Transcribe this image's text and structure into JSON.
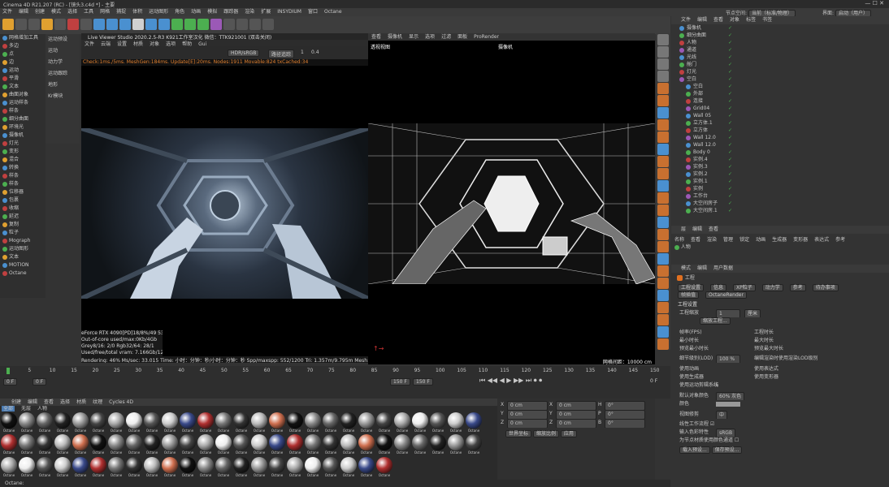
{
  "window": {
    "title": "Cinema 4D R21.207 (RC) - [镜头3.c4d *] - 主要"
  },
  "menubar": [
    "文件",
    "编辑",
    "创建",
    "模式",
    "选择",
    "工具",
    "网格",
    "捕捉",
    "体积",
    "运动图形",
    "角色",
    "动画",
    "模拟",
    "跟踪器",
    "渲染",
    "扩展",
    "INSYDIUM",
    "窗口",
    "Octane"
  ],
  "layout": {
    "label": "节点空间:",
    "value": "当前（标准/物理）",
    "interface_label": "界面:",
    "interface_value": "启动（用户）"
  },
  "left_sidebar": {
    "items": [
      "网格增加工具",
      "多边",
      "点",
      "边",
      "运动",
      "平滑",
      "文本",
      "曲面对象",
      "运动样条",
      "样条",
      "细分曲面",
      "环境光",
      "摄像机",
      "灯光",
      "变形",
      "混合",
      "转换",
      "样条",
      "样条",
      "位移器",
      "包裹",
      "收缩",
      "延迟",
      "复制",
      "粒子",
      "Mograph",
      "运动图形",
      "文本",
      "MOTION",
      "Octane"
    ],
    "tools": [
      "地图",
      "草图",
      "反射",
      "扭曲",
      "旋转",
      "挤压",
      "球化",
      "锥化",
      "样条",
      "螺旋",
      "循环",
      "运动样条",
      "多边形",
      "样条",
      "折纸",
      "点",
      "投射",
      "散射"
    ]
  },
  "mid_panel": {
    "items": [
      "运动预设",
      "运动",
      "动力学",
      "运动跟踪",
      "地形",
      "Kr模块"
    ],
    "selected": "XP系统"
  },
  "octane_viewer": {
    "title": "Live Viewer Studio 2020.2.5-R3  K921工作室汉化  微信：TTK921001  (双击关闭)",
    "menus": [
      "文件",
      "云端",
      "设置",
      "材质",
      "对象",
      "选项",
      "帮助",
      "Gui"
    ],
    "color_mode": "HDR/sRGB",
    "mode": "路径追踪",
    "value1": "1",
    "value2": "0.4",
    "status": "Check:1ms./5ms. MeshGen:184ms. Update[E]:20ms. Nodes:1911 Movable:824 txCached:34",
    "info_lines": [
      "eForce RTX 4090[PD]18/8%/49   53",
      "Out-of-core used/max:0Kb/4Gb",
      "Grey8/16: 2/0          Rgb32/64: 28/1",
      "Used/free/total vram: 7.166Gb/12.159Gb/2"
    ],
    "render_line": "Rendering: 46%  Ms/sec: 33.015  Time: 小时：分钟：秒/小时：分钟：秒   Spp/maxspp: 552/1200   Tri: 1.357m/9.795m   Mesh: 837   Hair: 0   RTXon"
  },
  "viewport": {
    "menus": [
      "查看",
      "摄像机",
      "显示",
      "选项",
      "过滤",
      "面板",
      "ProRender"
    ],
    "label": "透视视图",
    "camera": "摄像机",
    "grid": "网格间距：10000 cm"
  },
  "object_manager": {
    "tabs": [
      "文件",
      "编辑",
      "查看",
      "对象",
      "标签",
      "书签"
    ],
    "objects": [
      "摄像机",
      "细分曲面",
      "人物",
      "通道",
      "光线",
      "舱门",
      "灯光",
      "空白",
      "空白",
      "外部",
      "连接",
      "Grid04",
      "Wall 05",
      "立方体.1",
      "立方体",
      "Wall 12.0",
      "Wall 12.0",
      "Body 0",
      "实例.4",
      "实例.3",
      "实例.2",
      "实例.1",
      "实例",
      "工作台",
      "大空间房子",
      "大空间房.1"
    ]
  },
  "layer_panel": {
    "tabs": [
      "层",
      "编辑",
      "查看"
    ],
    "cols": [
      "名称",
      "查看",
      "渲染",
      "管理",
      "锁定",
      "动画",
      "生成器",
      "变形器",
      "表达式",
      "参考"
    ],
    "row": "人物"
  },
  "attributes": {
    "tabs": [
      "模式",
      "编辑",
      "用户数据"
    ],
    "title": "工程",
    "subtabs": [
      "工程设置",
      "信息",
      "XP粒子",
      "动力学",
      "参考",
      "待办事项"
    ],
    "subtabs2": [
      "帧插值",
      "OctaneRender"
    ],
    "section": "工程设置",
    "scale_label": "工程缩放",
    "scale_value": "1",
    "scale_unit": "厘米",
    "scale_btn": "缩放工程...",
    "fields": [
      {
        "l": "帧率(FPS)",
        "v": "30"
      },
      {
        "l": "最小时长",
        "v": "0 F"
      },
      {
        "l": "预览最小时长",
        "v": "0 F"
      }
    ],
    "fields_r": [
      {
        "l": "工程时长",
        "v": "0 F"
      },
      {
        "l": "最大时长",
        "v": "150 F"
      },
      {
        "l": "预览最大时长",
        "v": "150 F"
      }
    ],
    "lod_label": "细节级别(LOD)",
    "lod_value": "100 %",
    "lod_r": "编辑渲染时使用渲染LOD级别",
    "checks": [
      "使用动画",
      "使用生成器",
      "使用运动剪辑系统"
    ],
    "checks_r": [
      "使用表达式",
      "使用变形器"
    ],
    "default_color_label": "默认对象颜色",
    "default_color_value": "60% 灰色",
    "color_label": "颜色",
    "view_label": "视图修剪",
    "view_value": "中",
    "linear_label": "线性工作流程",
    "input_label": "输入色彩特性",
    "input_value": "sRGB",
    "node_label": "为节点材质使用颜色通道",
    "btn1": "载入预设...",
    "btn2": "保存预设..."
  },
  "timeline": {
    "ticks": [
      "0",
      "5",
      "10",
      "15",
      "20",
      "25",
      "30",
      "35",
      "40",
      "45",
      "50",
      "55",
      "60",
      "65",
      "70",
      "75",
      "80",
      "85",
      "90",
      "95",
      "100",
      "105",
      "110",
      "115",
      "120",
      "125",
      "130",
      "135",
      "140",
      "145",
      "150"
    ],
    "current": "0 F",
    "start": "0 F",
    "end": "150 F",
    "end2": "150 F",
    "frame_right": "0 F"
  },
  "material_manager": {
    "menus": [
      "创建",
      "编辑",
      "查看",
      "选择",
      "材质",
      "纹理",
      "Cycles 4D"
    ],
    "filters": [
      "全部",
      "无层",
      "人物"
    ],
    "materials": [
      "Octane",
      "Octane",
      "Octane",
      "Octane",
      "Octane",
      "Octane",
      "Octane",
      "Octane",
      "Octane",
      "Octane",
      "Octane",
      "Octane",
      "Octane",
      "Octane",
      "Octane",
      "Octane",
      "Octane",
      "Octane",
      "Octane",
      "Octane",
      "Octane",
      "Octane",
      "Octane",
      "Octane",
      "Octane",
      "Octane",
      "Octane",
      "Octane",
      "Octane",
      "Octane",
      "Octane",
      "Octane",
      "Octane",
      "Octane",
      "Octane",
      "Octane",
      "Octane",
      "Octane",
      "Octane",
      "Octane",
      "Octane",
      "Octane",
      "Octane",
      "Octane",
      "Octane",
      "Octane",
      "Octane",
      "Octane",
      "Octane",
      "Octane",
      "Octane",
      "Octane",
      "Octane",
      "Octane",
      "Octane",
      "Octane",
      "Octane",
      "Octane",
      "Octane",
      "Octane",
      "Octane",
      "Octane",
      "Octane",
      "Octane",
      "Octane",
      "Octane",
      "Octane",
      "Octane",
      "Octane",
      "Octane",
      "Octane",
      "Octane",
      "Octane",
      "Octane",
      "Octane",
      "Octane"
    ]
  },
  "coords": {
    "rows": [
      {
        "a": "X",
        "v1": "0 cm",
        "b": "X",
        "v2": "0 cm",
        "c": "H",
        "v3": "0°"
      },
      {
        "a": "Y",
        "v1": "0 cm",
        "b": "Y",
        "v2": "0 cm",
        "c": "P",
        "v3": "0°"
      },
      {
        "a": "Z",
        "v1": "0 cm",
        "b": "Z",
        "v2": "0 cm",
        "c": "B",
        "v3": "0°"
      }
    ],
    "mode": "世界坐标",
    "size": "缩放比例",
    "apply": "应用"
  },
  "status_bar": "Octane:"
}
